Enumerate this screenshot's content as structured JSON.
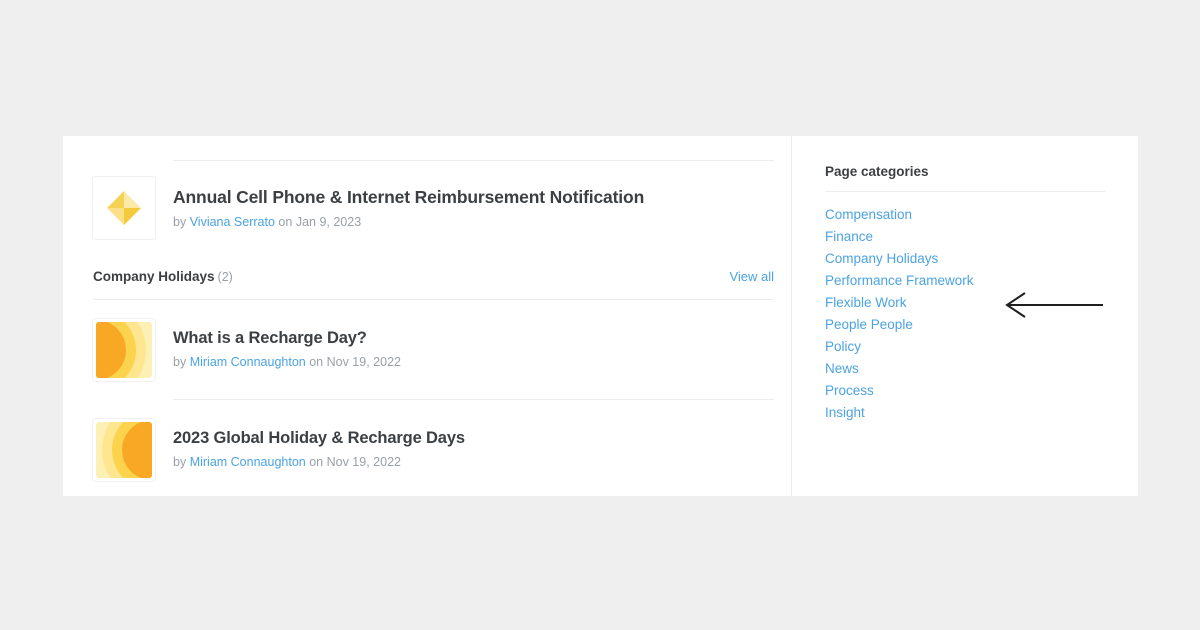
{
  "page": {
    "background_color": "#efefef",
    "card_background": "#ffffff",
    "link_color": "#4ba3e3",
    "text_color": "#3c4043",
    "muted_color": "#9aa0a6",
    "divider_color": "#ededed"
  },
  "featured": {
    "thumbnail_icon": "diamond-facets-icon",
    "title": "Annual Cell Phone & Internet Reimbursement Notification",
    "byline_prefix": "by",
    "author": "Viviana Serrato",
    "byline_middle": "on",
    "date": "Jan 9, 2023"
  },
  "section": {
    "title": "Company Holidays",
    "count": "(2)",
    "view_all_label": "View all",
    "items": [
      {
        "thumbnail_icon": "sunrise-arcs-left-icon",
        "title": "What is a Recharge Day?",
        "byline_prefix": "by",
        "author": "Miriam Connaughton",
        "byline_middle": "on",
        "date": "Nov 19, 2022"
      },
      {
        "thumbnail_icon": "sunrise-arcs-right-icon",
        "title": "2023 Global Holiday & Recharge Days",
        "byline_prefix": "by",
        "author": "Miriam Connaughton",
        "byline_middle": "on",
        "date": "Nov 19, 2022"
      }
    ]
  },
  "sidebar": {
    "title": "Page categories",
    "categories": [
      {
        "label": "Compensation"
      },
      {
        "label": "Finance"
      },
      {
        "label": "Company Holidays"
      },
      {
        "label": "Performance Framework"
      },
      {
        "label": "Flexible Work"
      },
      {
        "label": "People People"
      },
      {
        "label": "Policy"
      },
      {
        "label": "News"
      },
      {
        "label": "Process"
      },
      {
        "label": "Insight"
      }
    ]
  },
  "annotation": {
    "arrow_icon": "left-arrow-annotation",
    "arrow_color": "#1f1f1f",
    "points_to": "Flexible Work"
  }
}
